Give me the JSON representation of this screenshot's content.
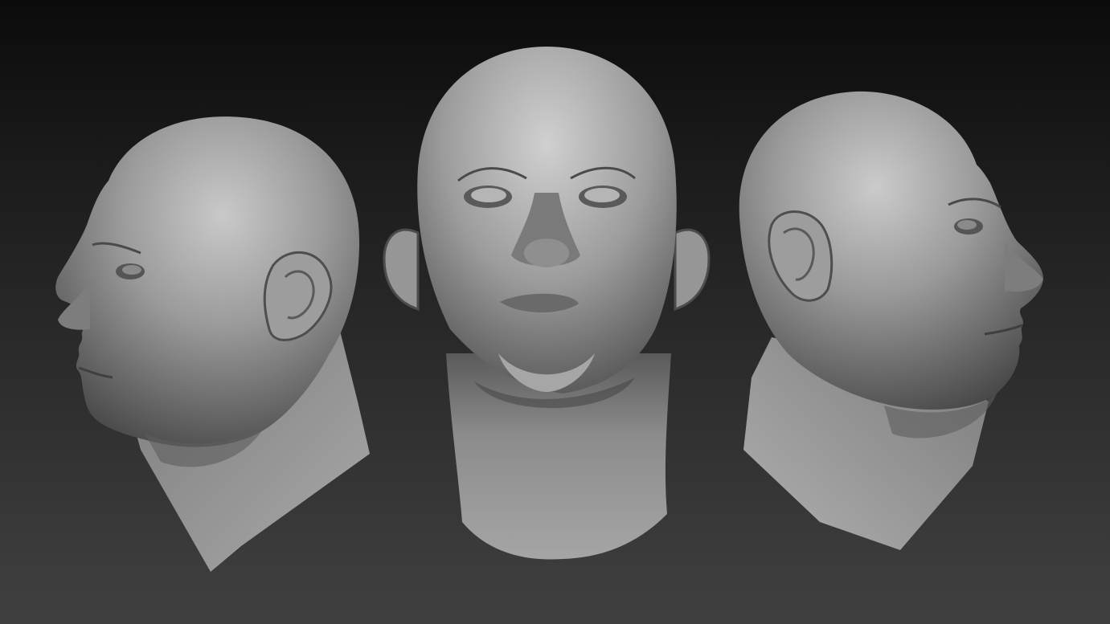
{
  "scene": {
    "background": {
      "top": "#0b0b0b",
      "bottom": "#404040"
    },
    "material": {
      "base": "#8e8e8e",
      "highlight": "#d2d2d2",
      "shadow": "#3a3a3a"
    },
    "views": [
      {
        "name": "left-profile",
        "facing": "left"
      },
      {
        "name": "front",
        "facing": "front"
      },
      {
        "name": "right-profile",
        "facing": "right"
      }
    ]
  }
}
